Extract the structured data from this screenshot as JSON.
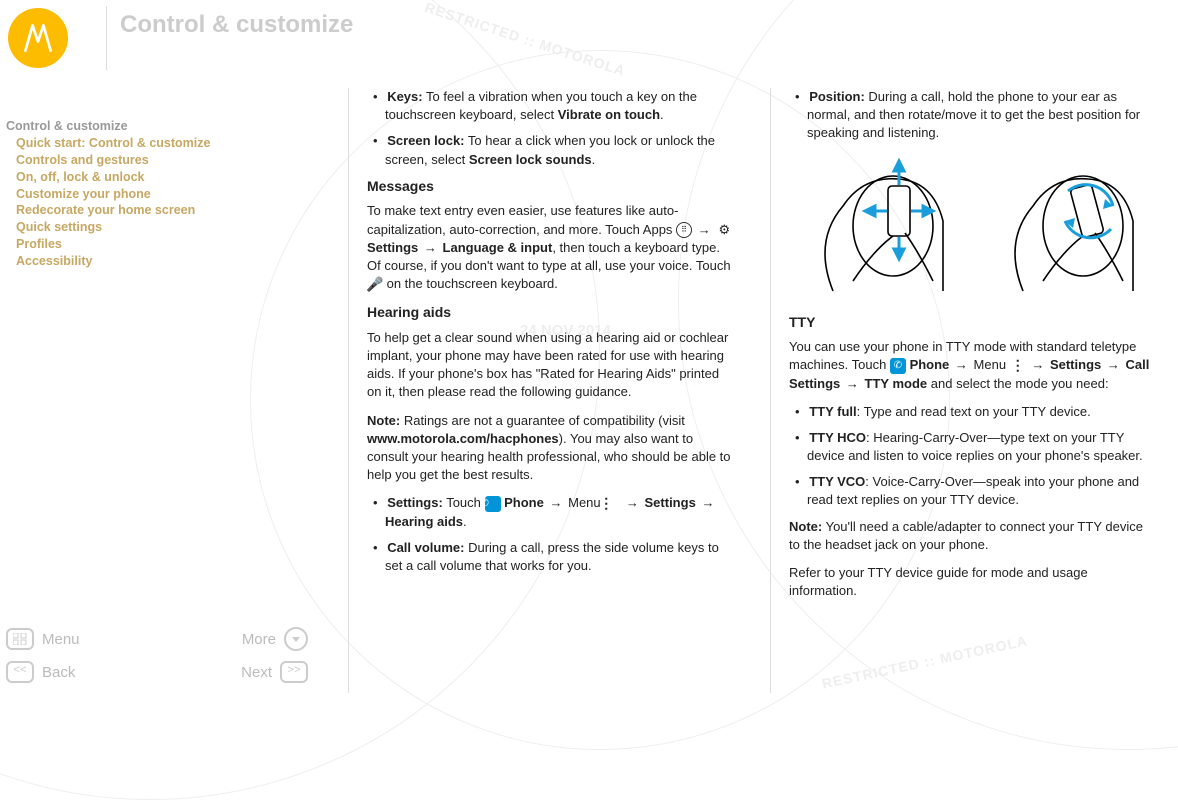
{
  "header": {
    "title": "Control & customize"
  },
  "sidebar": {
    "items": [
      {
        "label": "Control & customize",
        "current": true
      },
      {
        "label": "Quick start: Control & customize"
      },
      {
        "label": "Controls and gestures"
      },
      {
        "label": "On, off, lock & unlock"
      },
      {
        "label": "Customize your phone"
      },
      {
        "label": "Redecorate your home screen"
      },
      {
        "label": "Quick settings"
      },
      {
        "label": "Profiles"
      },
      {
        "label": "Accessibility"
      }
    ]
  },
  "nav": {
    "menu": "Menu",
    "more": "More",
    "back": "Back",
    "next": "Next"
  },
  "col1": {
    "keys_label": "Keys:",
    "keys_text": " To feel a vibration when you touch a key on the touchscreen keyboard, select ",
    "keys_bold": "Vibrate on touch",
    "keys_end": ".",
    "screenlock_label": "Screen lock:",
    "screenlock_text": " To hear a click when you lock or unlock the screen, select ",
    "screenlock_bold": "Screen lock sounds",
    "screenlock_end": ".",
    "messages_h": "Messages",
    "messages_p1a": "To make text entry even easier, use features like auto-capitalization, auto-correction, and more. Touch Apps ",
    "messages_p1b_settings": "Settings",
    "messages_p1b_lang": "Language & input",
    "messages_p1c": ", then touch a keyboard type. Of course, if you don't want to type at all, use your voice. Touch ",
    "messages_p1d": " on the touchscreen keyboard.",
    "hearing_h": "Hearing aids",
    "hearing_p1": "To help get a clear sound when using a hearing aid or cochlear implant, your phone may have been rated for use with hearing aids. If your phone's box has \"Rated for Hearing Aids\" printed on it, then please read the following guidance.",
    "note_label": "Note:",
    "note_text_a": " Ratings are not a guarantee of compatibility (visit ",
    "note_url": "www.motorola.com/hacphones",
    "note_text_b": "). You may also want to consult your hearing health professional, who should be able to help you get the best results.",
    "settings_label": "Settings:",
    "settings_text_a": " Touch ",
    "settings_phone": "Phone",
    "settings_menu": "Menu",
    "settings_settings": "Settings",
    "settings_ha": "Hearing aids",
    "settings_end": ".",
    "callvol_label": "Call volume:",
    "callvol_text": " During a call, press the side volume keys to set a call volume that works for you."
  },
  "col2": {
    "position_label": "Position:",
    "position_text": " During a call, hold the phone to your ear as normal, and then rotate/move it to get the best position for speaking and listening.",
    "tty_h": "TTY",
    "tty_p_a": "You can use your phone in TTY mode with standard teletype machines. Touch ",
    "tty_phone": "Phone",
    "tty_menu": "Menu",
    "tty_settings": "Settings",
    "tty_call_settings": "Call Settings",
    "tty_mode": "TTY mode",
    "tty_p_b": " and select the mode you need:",
    "tty_full_label": "TTY full",
    "tty_full_text": ": Type and read text on your TTY device.",
    "tty_hco_label": "TTY HCO",
    "tty_hco_text": ": Hearing-Carry-Over—type text on your TTY device and listen to voice replies on your phone's speaker.",
    "tty_vco_label": "TTY VCO",
    "tty_vco_text": ": Voice-Carry-Over—speak into your phone and read text replies on your TTY device.",
    "tty_note_label": "Note:",
    "tty_note_text": " You'll need a cable/adapter to connect your TTY device to the headset jack on your phone.",
    "tty_refer": "Refer to your TTY device guide for mode and usage information."
  },
  "watermark": {
    "date": "24 NOV 2014"
  }
}
